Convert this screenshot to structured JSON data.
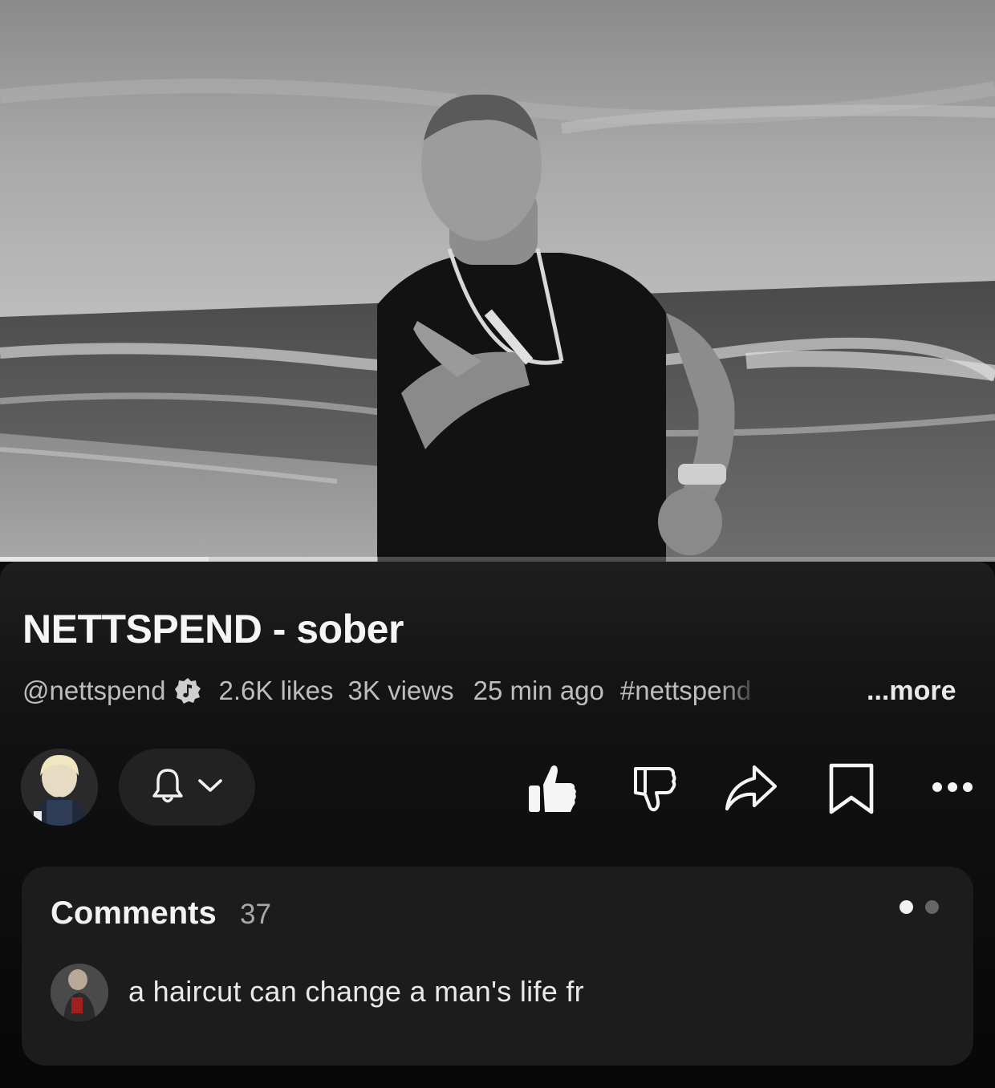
{
  "video": {
    "progress_fraction": 0.21,
    "buffered_fraction": 0.38
  },
  "title": "NETTSPEND - sober",
  "meta": {
    "handle": "@nettspend",
    "likes": "2.6K likes",
    "views": "3K views",
    "age": "25 min ago",
    "hashtag": "#nettspend",
    "more_label": "...more"
  },
  "actions": {
    "icons": [
      "bell-icon",
      "chevron-down-icon",
      "thumbs-up-icon",
      "thumbs-down-icon",
      "share-icon",
      "bookmark-icon",
      "more-icon"
    ]
  },
  "comments": {
    "title": "Comments",
    "count": "37",
    "top_comment": "a haircut can change a man's life fr"
  },
  "colors": {
    "background": "#0b0b0b",
    "sheet": "#1e1e1e",
    "comments_bg": "#1c1c1c",
    "text_primary": "#f5f5f5",
    "text_secondary": "#bdbdbd"
  }
}
